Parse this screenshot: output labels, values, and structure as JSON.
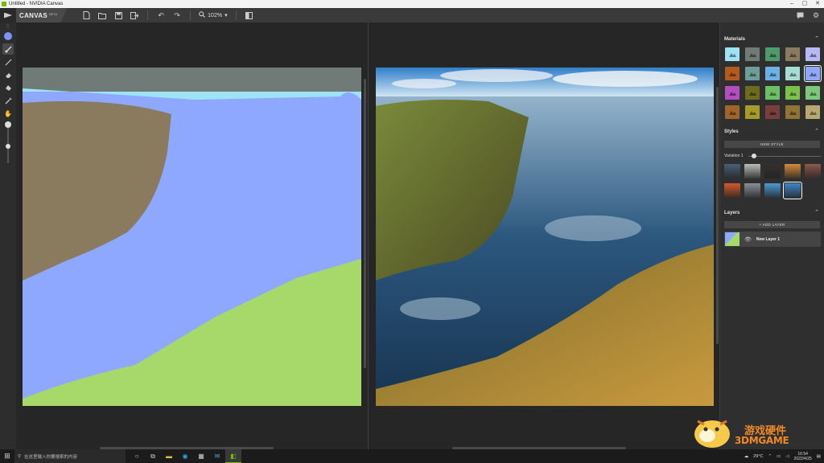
{
  "window": {
    "title": "Untitled - NVIDIA Canvas",
    "min_icon": "minimize-icon",
    "max_icon": "maximize-icon",
    "close_icon": "close-icon"
  },
  "toolbar": {
    "brand_name": "CANVAS",
    "brand_badge": "BETA",
    "zoom_value": "102%"
  },
  "tools": [
    {
      "name": "color-picker-icon"
    },
    {
      "name": "brush-icon"
    },
    {
      "name": "line-icon"
    },
    {
      "name": "eraser-icon"
    },
    {
      "name": "fill-icon"
    },
    {
      "name": "eyedropper-icon"
    },
    {
      "name": "pan-hand-icon"
    }
  ],
  "panel": {
    "materials_title": "Materials",
    "styles_title": "Styles",
    "new_style_label": "NEW STYLE",
    "variation_label": "Variation 1",
    "layers_title": "Layers",
    "add_layer_label": "+ ADD LAYER",
    "layer_name": "New Layer 1"
  },
  "materials": [
    {
      "name": "sky",
      "color": "#9ee3f5"
    },
    {
      "name": "cloud",
      "color": "#707a76"
    },
    {
      "name": "grass",
      "color": "#4f9a6a"
    },
    {
      "name": "mountain",
      "color": "#8a7a5e"
    },
    {
      "name": "snow",
      "color": "#b8b8f5"
    },
    {
      "name": "dirt",
      "color": "#b45a1e"
    },
    {
      "name": "house",
      "color": "#6e9e9a"
    },
    {
      "name": "ice",
      "color": "#6bb0e6"
    },
    {
      "name": "fog",
      "color": "#a6dcd2"
    },
    {
      "name": "water",
      "color": "#8fa8ff"
    },
    {
      "name": "flower",
      "color": "#b44ec0"
    },
    {
      "name": "sand",
      "color": "#6e6a1e"
    },
    {
      "name": "hill",
      "color": "#6bbf64"
    },
    {
      "name": "tree",
      "color": "#7ac24a"
    },
    {
      "name": "bush",
      "color": "#7cc87a"
    },
    {
      "name": "rock",
      "color": "#a0642a"
    },
    {
      "name": "palm",
      "color": "#a59a2a"
    },
    {
      "name": "stone",
      "color": "#7a3e3e"
    },
    {
      "name": "shrub",
      "color": "#8f7436"
    },
    {
      "name": "wall",
      "color": "#b6a86e"
    }
  ],
  "styles": [
    {
      "name": "style-1",
      "color": "#4a5e7a"
    },
    {
      "name": "style-2",
      "color": "#b7bdb8"
    },
    {
      "name": "style-3",
      "color": "#35302e"
    },
    {
      "name": "style-4",
      "color": "#d48a3a"
    },
    {
      "name": "style-5",
      "color": "#8a5a4a"
    },
    {
      "name": "style-6",
      "color": "#d25a2a"
    },
    {
      "name": "style-7",
      "color": "#8a9098"
    },
    {
      "name": "style-8",
      "color": "#4e9ad4"
    },
    {
      "name": "style-9",
      "color": "#3e86c8"
    }
  ],
  "taskbar": {
    "search_placeholder": "在这里输入你要搜索的内容",
    "weather": "29°C",
    "time": "16:54",
    "date": "2022/4/25"
  },
  "watermark": {
    "cn": "游戏硬件",
    "en": "3DMGAME"
  }
}
